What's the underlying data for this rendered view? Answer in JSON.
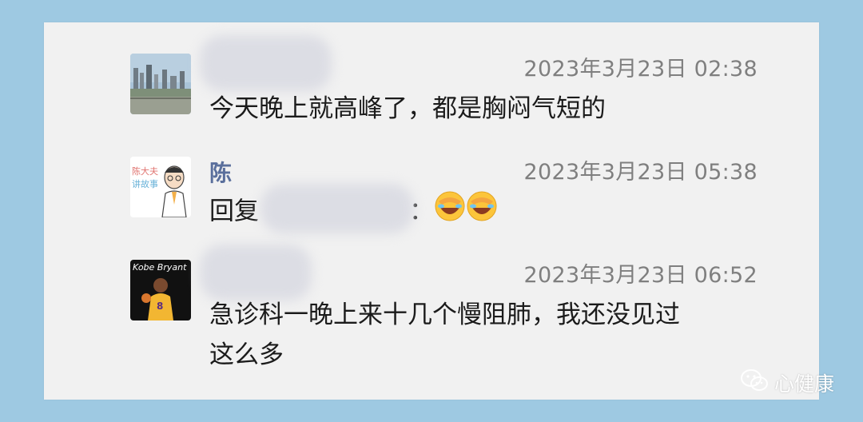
{
  "messages": [
    {
      "name": "",
      "time": "2023年3月23日 02:38",
      "lines": [
        "今天晚上就高峰了，都是胸闷气短的"
      ]
    },
    {
      "name": "陈",
      "time": "2023年3月23日 05:38",
      "reply_prefix": "回复",
      "reply_suffix": "：",
      "avatar_text_1": "陈大夫",
      "avatar_text_2": "讲故事"
    },
    {
      "name": "",
      "time": "2023年3月23日 06:52",
      "lines": [
        "急诊科一晚上来十几个慢阻肺，我还没见过",
        "这么多"
      ],
      "avatar_text": "Kobe Bryant"
    }
  ],
  "watermark": {
    "text": "心健康"
  }
}
